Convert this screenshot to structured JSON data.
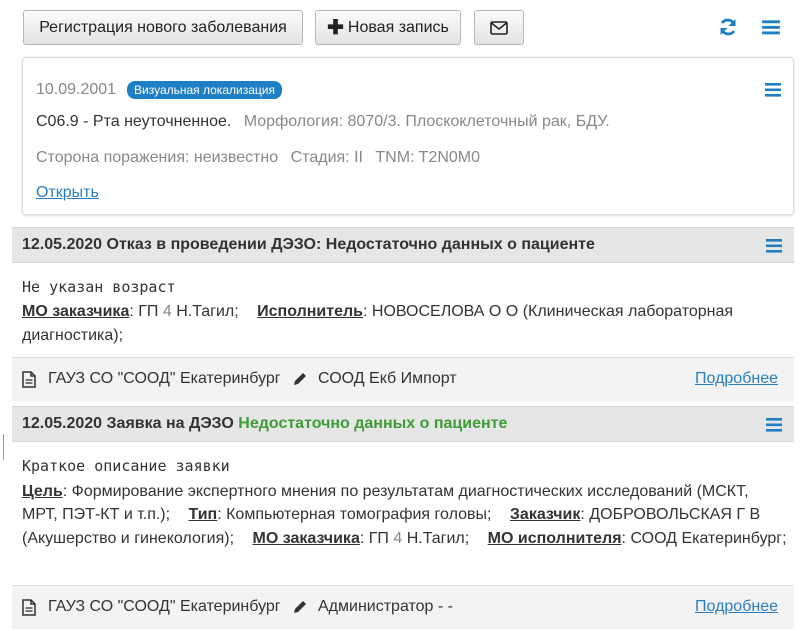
{
  "toolbar": {
    "register_label": "Регистрация нового заболевания",
    "new_record_label": "Новая запись",
    "plus_glyph": "✚",
    "icons": [
      "envelope-icon",
      "refresh-icon",
      "menu-icon"
    ]
  },
  "diagnosis_card": {
    "date": "10.09.2001",
    "badge": "Визуальная локализация",
    "code_text": "C06.9 - Рта неуточненное.",
    "morphology_label": "Морфология:",
    "morphology_code": "8070/3.",
    "morphology_desc": "Плоскоклеточный рак, БДУ.",
    "side_label": "Сторона поражения:",
    "side_value": "неизвестно",
    "stage_label": "Стадия:",
    "stage_value": "II",
    "tnm_label": "TNM:",
    "tnm_value": "T2N0M0",
    "open_link": "Открыть"
  },
  "events": [
    {
      "title": "12.05.2020 Отказ в проведении ДЭЗО: Недостаточно данных о пациенте",
      "mono_line": "Не указан возраст",
      "mo_customer_label": "МО заказчика",
      "mo_customer_value_a": ": ГП ",
      "mo_customer_value_num": "4",
      "mo_customer_value_b": " Н.Тагил;",
      "executor_label": "Исполнитель",
      "executor_value": ": НОВОСЕЛОВА О О (Клиническая лабораторная",
      "executor_value_2": "диагностика);",
      "footer_org": "ГАУЗ СО \"СООД\" Екатеринбург",
      "footer_author": "СООД Екб Импорт",
      "footer_link": "Подробнее"
    },
    {
      "title_a": "12.05.2020 Заявка на ДЭЗО",
      "title_b": "Недостаточно данных о пациенте",
      "mono_line": "Краткое описание заявки",
      "goal_label": "Цель",
      "goal_value": ": Формирование экспертного мнения по результатам диагностических исследований (МСКТ,",
      "goal_value_2": "МРТ, ПЭТ-КТ и т.п.);",
      "type_label": "Тип",
      "type_value": ": Компьютерная томография головы;",
      "customer_label": "Заказчик",
      "customer_value": ": ДОБРОВОЛЬСКАЯ Г В",
      "customer_value_2": "(Акушерство и гинекология);",
      "mo_customer_label": "МО заказчика",
      "mo_customer_value_a": ": ГП ",
      "mo_customer_value_num": "4",
      "mo_customer_value_b": " Н.Тагил;",
      "mo_executor_label": "МО исполнителя",
      "mo_executor_value": ": СООД Екатеринбург;",
      "footer_org": "ГАУЗ СО \"СООД\" Екатеринбург",
      "footer_author": "Администратор - -",
      "footer_link": "Подробнее"
    }
  ],
  "colors": {
    "accent": "#1f7fc5",
    "link": "#2a7ec0",
    "success": "#3e9c35",
    "muted": "#888888"
  }
}
